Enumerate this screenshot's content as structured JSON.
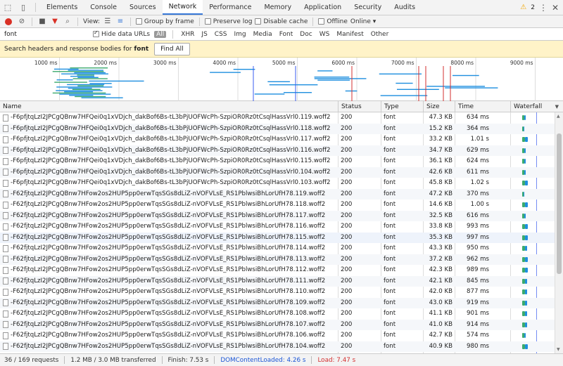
{
  "tabs": [
    "Elements",
    "Console",
    "Sources",
    "Network",
    "Performance",
    "Memory",
    "Application",
    "Security",
    "Audits"
  ],
  "active_tab": "Network",
  "warning_count": "2",
  "toolbar": {
    "view_label": "View:",
    "group_by_frame": "Group by frame",
    "preserve_log": "Preserve log",
    "disable_cache": "Disable cache",
    "offline": "Offline",
    "throttle": "Online"
  },
  "filter": {
    "value": "font",
    "hide_data_urls": "Hide data URLs",
    "types": [
      "All",
      "XHR",
      "JS",
      "CSS",
      "Img",
      "Media",
      "Font",
      "Doc",
      "WS",
      "Manifest",
      "Other"
    ]
  },
  "search": {
    "prefix": "Search headers and response bodies for",
    "term": "font",
    "button": "Find All"
  },
  "timeline": {
    "ticks": [
      "1000 ms",
      "2000 ms",
      "3000 ms",
      "4000 ms",
      "5000 ms",
      "6000 ms",
      "7000 ms",
      "8000 ms",
      "9000 ms"
    ]
  },
  "columns": {
    "name": "Name",
    "status": "Status",
    "type": "Type",
    "size": "Size",
    "time": "Time",
    "waterfall": "Waterfall"
  },
  "rows": [
    {
      "name": "-F6pfjtqLzI2JPCgQBnw7HFQei0q1xVDjch_dakBof6Bs-tL3bPjUOFWcPh-SzpiOR0Rz0tCsqlHassVrl0.119.woff2",
      "status": "200",
      "type": "font",
      "size": "47.3 KB",
      "time": "634 ms"
    },
    {
      "name": "-F6pfjtqLzI2JPCgQBnw7HFQei0q1xVDjch_dakBof6Bs-tL3bPjUOFWcPh-SzpiOR0Rz0tCsqlHassVrl0.118.woff2",
      "status": "200",
      "type": "font",
      "size": "15.2 KB",
      "time": "364 ms"
    },
    {
      "name": "-F6pfjtqLzI2JPCgQBnw7HFQei0q1xVDjch_dakBof6Bs-tL3bPjUOFWcPh-SzpiOR0Rz0tCsqlHassVrl0.117.woff2",
      "status": "200",
      "type": "font",
      "size": "33.2 KB",
      "time": "1.01 s"
    },
    {
      "name": "-F6pfjtqLzI2JPCgQBnw7HFQei0q1xVDjch_dakBof6Bs-tL3bPjUOFWcPh-SzpiOR0Rz0tCsqlHassVrl0.116.woff2",
      "status": "200",
      "type": "font",
      "size": "34.7 KB",
      "time": "629 ms"
    },
    {
      "name": "-F6pfjtqLzI2JPCgQBnw7HFQei0q1xVDjch_dakBof6Bs-tL3bPjUOFWcPh-SzpiOR0Rz0tCsqlHassVrl0.115.woff2",
      "status": "200",
      "type": "font",
      "size": "36.1 KB",
      "time": "624 ms"
    },
    {
      "name": "-F6pfjtqLzI2JPCgQBnw7HFQei0q1xVDjch_dakBof6Bs-tL3bPjUOFWcPh-SzpiOR0Rz0tCsqlHassVrl0.104.woff2",
      "status": "200",
      "type": "font",
      "size": "42.6 KB",
      "time": "611 ms"
    },
    {
      "name": "-F6pfjtqLzI2JPCgQBnw7HFQei0q1xVDjch_dakBof6Bs-tL3bPjUOFWcPh-SzpiOR0Rz0tCsqlHassVrl0.103.woff2",
      "status": "200",
      "type": "font",
      "size": "45.8 KB",
      "time": "1.02 s"
    },
    {
      "name": "-F62fjtqLzI2JPCgQBnw7HFow2os2HUP5pp0erwTqsSGs8dLiZ-nVOFVLsE_RS1PblwsiBhLorUfH78.119.woff2",
      "status": "200",
      "type": "font",
      "size": "47.2 KB",
      "time": "370 ms"
    },
    {
      "name": "-F62fjtqLzI2JPCgQBnw7HFow2os2HUP5pp0erwTqsSGs8dLiZ-nVOFVLsE_RS1PblwsiBhLorUfH78.118.woff2",
      "status": "200",
      "type": "font",
      "size": "14.6 KB",
      "time": "1.00 s"
    },
    {
      "name": "-F62fjtqLzI2JPCgQBnw7HFow2os2HUP5pp0erwTqsSGs8dLiZ-nVOFVLsE_RS1PblwsiBhLorUfH78.117.woff2",
      "status": "200",
      "type": "font",
      "size": "32.5 KB",
      "time": "616 ms"
    },
    {
      "name": "-F62fjtqLzI2JPCgQBnw7HFow2os2HUP5pp0erwTqsSGs8dLiZ-nVOFVLsE_RS1PblwsiBhLorUfH78.116.woff2",
      "status": "200",
      "type": "font",
      "size": "33.8 KB",
      "time": "993 ms"
    },
    {
      "name": "-F62fjtqLzI2JPCgQBnw7HFow2os2HUP5pp0erwTqsSGs8dLiZ-nVOFVLsE_RS1PblwsiBhLorUfH78.115.woff2",
      "status": "200",
      "type": "font",
      "size": "35.3 KB",
      "time": "997 ms"
    },
    {
      "name": "-F62fjtqLzI2JPCgQBnw7HFow2os2HUP5pp0erwTqsSGs8dLiZ-nVOFVLsE_RS1PblwsiBhLorUfH78.114.woff2",
      "status": "200",
      "type": "font",
      "size": "43.3 KB",
      "time": "950 ms"
    },
    {
      "name": "-F62fjtqLzI2JPCgQBnw7HFow2os2HUP5pp0erwTqsSGs8dLiZ-nVOFVLsE_RS1PblwsiBhLorUfH78.113.woff2",
      "status": "200",
      "type": "font",
      "size": "37.2 KB",
      "time": "962 ms"
    },
    {
      "name": "-F62fjtqLzI2JPCgQBnw7HFow2os2HUP5pp0erwTqsSGs8dLiZ-nVOFVLsE_RS1PblwsiBhLorUfH78.112.woff2",
      "status": "200",
      "type": "font",
      "size": "42.3 KB",
      "time": "989 ms"
    },
    {
      "name": "-F62fjtqLzI2JPCgQBnw7HFow2os2HUP5pp0erwTqsSGs8dLiZ-nVOFVLsE_RS1PblwsiBhLorUfH78.111.woff2",
      "status": "200",
      "type": "font",
      "size": "42.1 KB",
      "time": "845 ms"
    },
    {
      "name": "-F62fjtqLzI2JPCgQBnw7HFow2os2HUP5pp0erwTqsSGs8dLiZ-nVOFVLsE_RS1PblwsiBhLorUfH78.110.woff2",
      "status": "200",
      "type": "font",
      "size": "42.0 KB",
      "time": "877 ms"
    },
    {
      "name": "-F62fjtqLzI2JPCgQBnw7HFow2os2HUP5pp0erwTqsSGs8dLiZ-nVOFVLsE_RS1PblwsiBhLorUfH78.109.woff2",
      "status": "200",
      "type": "font",
      "size": "43.0 KB",
      "time": "919 ms"
    },
    {
      "name": "-F62fjtqLzI2JPCgQBnw7HFow2os2HUP5pp0erwTqsSGs8dLiZ-nVOFVLsE_RS1PblwsiBhLorUfH78.108.woff2",
      "status": "200",
      "type": "font",
      "size": "41.1 KB",
      "time": "901 ms"
    },
    {
      "name": "-F62fjtqLzI2JPCgQBnw7HFow2os2HUP5pp0erwTqsSGs8dLiZ-nVOFVLsE_RS1PblwsiBhLorUfH78.107.woff2",
      "status": "200",
      "type": "font",
      "size": "41.0 KB",
      "time": "914 ms"
    },
    {
      "name": "-F62fjtqLzI2JPCgQBnw7HFow2os2HUP5pp0erwTqsSGs8dLiZ-nVOFVLsE_RS1PblwsiBhLorUfH78.106.woff2",
      "status": "200",
      "type": "font",
      "size": "42.7 KB",
      "time": "574 ms"
    },
    {
      "name": "-F62fjtqLzI2JPCgQBnw7HFow2os2HUP5pp0erwTqsSGs8dLiZ-nVOFVLsE_RS1PblwsiBhLorUfH78.104.woff2",
      "status": "200",
      "type": "font",
      "size": "40.9 KB",
      "time": "980 ms"
    }
  ],
  "status_bar": {
    "requests": "36 / 169 requests",
    "transferred": "1.2 MB / 3.0 MB transferred",
    "finish": "Finish: 7.53 s",
    "dom_content_loaded": "DOMContentLoaded: 4.26 s",
    "load": "Load: 7.47 s"
  },
  "colors": {
    "accent": "#3879d9",
    "record": "#d93025",
    "search_bg": "#fff3c8",
    "dcl": "#1a55d6",
    "load": "#d32f2f"
  }
}
